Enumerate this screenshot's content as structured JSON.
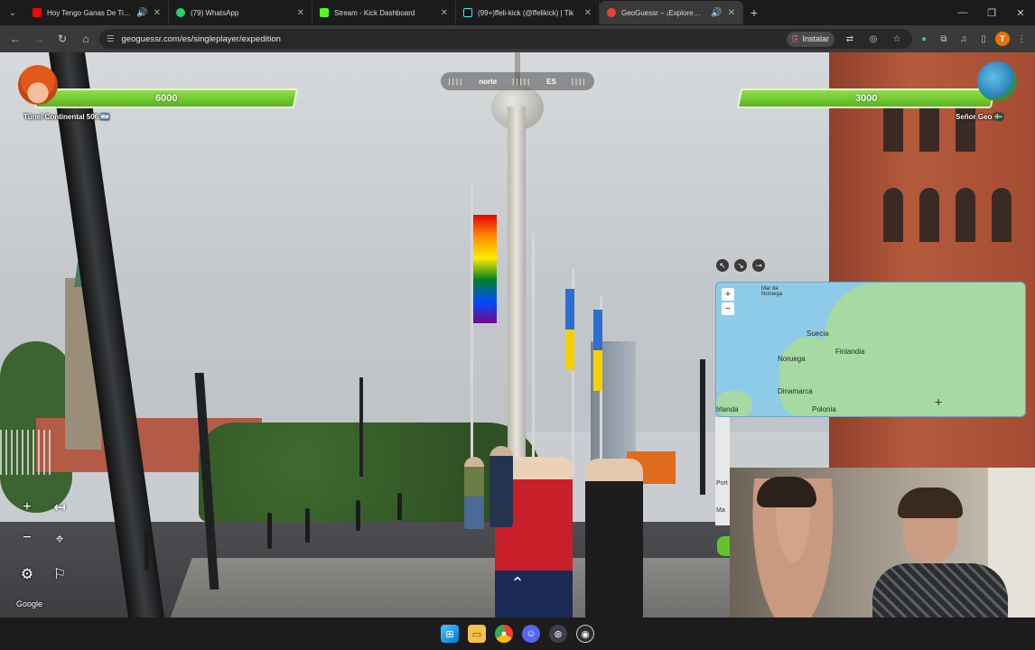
{
  "browser": {
    "tabs": [
      {
        "title": "Hoy Tengo Ganas De Ti (En",
        "favicon_color": "#ff0000",
        "active": false
      },
      {
        "title": "(79) WhatsApp",
        "favicon_color": "#25d366",
        "active": false
      },
      {
        "title": "Stream - Kick Dashboard",
        "favicon_color": "#53fc18",
        "active": false
      },
      {
        "title": "(99+)ffeli-kick (@ffelikick) | Tik",
        "favicon_color": "#111111",
        "active": false
      },
      {
        "title": "GeoGuessr – ¡Exploremos el",
        "favicon_color": "#ea4335",
        "active": true
      }
    ],
    "new_tab_icon": "plus-icon",
    "url": "geoguessr.com/es/singleplayer/expedition",
    "install_label": "Instalar",
    "profile_initial": "T"
  },
  "game": {
    "compass": {
      "left_label": "norte",
      "right_label": "ES"
    },
    "player1": {
      "name": "Túnel Continental 506",
      "score": "6000",
      "flag": "🇦🇷",
      "health_fraction": 1.0
    },
    "player2": {
      "name": "Señor Geo",
      "score": "3000",
      "flag": "🇸🇪",
      "health_fraction": 1.0
    },
    "google_label": "Google"
  },
  "map": {
    "labels": {
      "sea": "Mar de Noruega",
      "suecia": "Suecia",
      "finlandia": "Finlandia",
      "noruega": "Noruega",
      "dinamarca": "Dinamarca",
      "irlanda": "Irlanda",
      "polonia": "Polonia",
      "port": "Port",
      "ma": "Ma"
    },
    "zoom_in": "+",
    "zoom_out": "−"
  },
  "colors": {
    "health_green": "#6cc63a",
    "chrome_dark": "#1b1b1b",
    "toolbar": "#3a3a3a"
  }
}
